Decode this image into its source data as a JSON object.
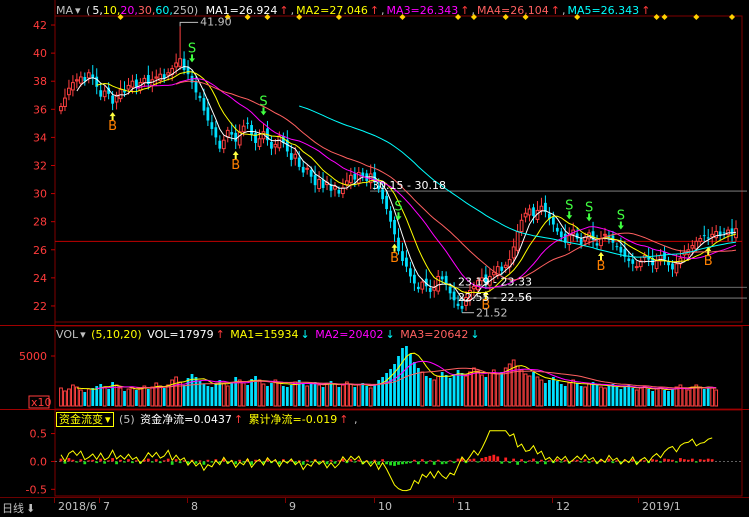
{
  "main_header": {
    "indicator": "MA",
    "params": [
      "5",
      "10",
      "20",
      "30",
      "60",
      "250"
    ],
    "ma": [
      {
        "label": "MA1=26.924",
        "color": "#ffffff"
      },
      {
        "label": "MA2=27.046",
        "color": "#ffff00"
      },
      {
        "label": "MA3=26.343",
        "color": "#ff00ff"
      },
      {
        "label": "MA4=26.104",
        "color": "#ff6060"
      },
      {
        "label": "MA5=26.343",
        "color": "#00ffff"
      }
    ]
  },
  "vol_header": {
    "indicator": "VOL",
    "params": "(5,10,20)",
    "vol": "VOL=17979",
    "ma1": "MA1=15934",
    "ma2": "MA2=20402",
    "ma3": "MA3=20642"
  },
  "fund_header": {
    "indicator": "资金流变",
    "param": "(5)",
    "net": "资金净流=0.0437",
    "cum": "累计净流=-0.019",
    "tail": ","
  },
  "bottom": {
    "period_label": "日线",
    "dates": [
      "2018/6",
      "7",
      "8",
      "9",
      "10",
      "11",
      "12",
      "2019/1"
    ]
  },
  "chart_data": [
    {
      "type": "candlestick",
      "title": "",
      "y_ticks": [
        22,
        24,
        26,
        28,
        30,
        32,
        34,
        36,
        38,
        40,
        42
      ],
      "ylim": [
        21.0,
        42.5
      ],
      "annotations": [
        {
          "text": "41.90",
          "kind": "high"
        },
        {
          "text": "21.52",
          "kind": "low"
        },
        {
          "text": "30.15 - 30.18",
          "kind": "gap"
        },
        {
          "text": "23.19 - 23.33",
          "kind": "gap"
        },
        {
          "text": "22.55 - 22.56",
          "kind": "gap"
        }
      ],
      "reference_line": 26.6,
      "gap_levels": [
        30.18,
        23.33,
        22.56
      ],
      "signals": [
        {
          "type": "B",
          "i": 13
        },
        {
          "type": "S",
          "i": 33
        },
        {
          "type": "B",
          "i": 44
        },
        {
          "type": "S",
          "i": 51
        },
        {
          "type": "S",
          "i": 85
        },
        {
          "type": "B",
          "i": 84
        },
        {
          "type": "B",
          "i": 107
        },
        {
          "type": "S",
          "i": 128
        },
        {
          "type": "S",
          "i": 133
        },
        {
          "type": "B",
          "i": 136
        },
        {
          "type": "S",
          "i": 141
        },
        {
          "type": "B",
          "i": 163
        }
      ],
      "series": {
        "close": [
          36.2,
          36.8,
          37.5,
          37.9,
          38.1,
          38.3,
          38.0,
          38.6,
          38.2,
          37.6,
          36.9,
          37.3,
          37.1,
          36.4,
          37.0,
          37.4,
          37.2,
          37.7,
          38.0,
          37.6,
          37.9,
          38.2,
          37.8,
          38.1,
          38.3,
          38.5,
          38.2,
          38.6,
          38.9,
          39.3,
          39.6,
          38.8,
          38.5,
          37.9,
          37.2,
          36.8,
          35.9,
          35.2,
          34.6,
          34.0,
          33.2,
          33.8,
          34.5,
          34.2,
          33.7,
          34.4,
          34.8,
          35.0,
          34.2,
          33.6,
          33.9,
          34.4,
          33.8,
          33.2,
          33.5,
          34.1,
          33.6,
          33.0,
          32.4,
          32.8,
          31.9,
          31.5,
          31.8,
          31.2,
          30.6,
          31.0,
          30.4,
          30.8,
          30.2,
          30.5,
          30.0,
          30.4,
          30.9,
          31.3,
          31.0,
          31.5,
          31.2,
          30.9,
          31.4,
          30.8,
          30.3,
          29.6,
          28.9,
          28.0,
          27.1,
          25.9,
          25.2,
          24.8,
          24.1,
          23.6,
          23.2,
          23.7,
          23.4,
          23.0,
          23.3,
          24.1,
          23.9,
          23.5,
          22.9,
          22.4,
          22.0,
          21.8,
          22.6,
          23.1,
          23.4,
          23.8,
          24.0,
          23.6,
          24.1,
          24.4,
          24.8,
          24.5,
          24.9,
          25.3,
          26.2,
          27.3,
          28.1,
          28.6,
          28.9,
          28.4,
          28.8,
          29.1,
          28.7,
          28.2,
          27.8,
          27.3,
          26.9,
          26.5,
          27.0,
          27.4,
          26.8,
          26.4,
          26.9,
          27.2,
          26.7,
          26.3,
          26.8,
          27.1,
          26.9,
          26.5,
          26.2,
          25.8,
          25.5,
          25.2,
          25.0,
          24.8,
          25.2,
          25.6,
          25.3,
          24.9,
          25.2,
          25.6,
          25.3,
          24.9,
          24.6,
          25.0,
          25.4,
          25.8,
          26.0,
          26.3,
          26.6,
          26.8,
          27.0,
          26.8,
          27.1,
          27.3,
          27.0,
          27.2,
          27.4,
          27.1,
          27.5
        ],
        "ma_white": [],
        "ma_yellow": [],
        "ma_magenta": [],
        "ma_red": [],
        "ma_cyan_start": 60
      }
    },
    {
      "type": "bar",
      "title": "",
      "y_ticks": [
        5000
      ],
      "ylim": [
        0,
        6200
      ],
      "unit": "x10",
      "volume": [
        1800,
        1500,
        1700,
        2100,
        1900,
        1600,
        1400,
        1700,
        1800,
        2000,
        2200,
        1900,
        1700,
        2400,
        2100,
        1800,
        1500,
        1700,
        1900,
        1600,
        1800,
        2000,
        1700,
        1900,
        2300,
        2000,
        1800,
        2100,
        2600,
        2900,
        2400,
        2100,
        2800,
        3200,
        2900,
        2500,
        2200,
        2000,
        1900,
        2300,
        2600,
        2300,
        2000,
        2400,
        2900,
        2600,
        2300,
        2100,
        2700,
        3000,
        2600,
        2200,
        2000,
        2300,
        2600,
        2300,
        2000,
        1900,
        2100,
        2400,
        2600,
        2300,
        2000,
        2200,
        2400,
        2100,
        1900,
        2200,
        2500,
        2200,
        1900,
        2100,
        2400,
        2200,
        1900,
        2100,
        2300,
        2000,
        1800,
        2200,
        2600,
        2900,
        3300,
        3700,
        4200,
        5000,
        5800,
        6000,
        5200,
        4400,
        3800,
        3400,
        3000,
        2800,
        2600,
        3000,
        3400,
        3100,
        2800,
        3200,
        3600,
        3300,
        3000,
        3400,
        3800,
        3500,
        3100,
        2900,
        3300,
        3600,
        3200,
        3400,
        3800,
        4200,
        4600,
        4000,
        3600,
        3200,
        3000,
        3400,
        2900,
        2600,
        2300,
        2600,
        2900,
        2500,
        2200,
        2000,
        2300,
        2600,
        2300,
        2000,
        1900,
        2200,
        2400,
        2100,
        1900,
        1800,
        2000,
        2200,
        1900,
        1700,
        1900,
        2100,
        1800,
        1600,
        1800,
        2000,
        1700,
        1500,
        1700,
        1900,
        1600,
        1500,
        1700,
        1900,
        2100,
        1800,
        1600,
        1900,
        2100,
        1900,
        1700,
        1900,
        1800,
        1600
      ]
    },
    {
      "type": "bar",
      "title": "",
      "y_ticks": [
        0.5,
        0.0,
        -0.5
      ],
      "ylim": [
        -0.62,
        0.6
      ],
      "flows": [
        0.05,
        -0.04,
        0.06,
        0.03,
        -0.02,
        0.04,
        -0.05,
        0.02,
        0.03,
        -0.03,
        0.05,
        -0.04,
        0.02,
        0.06,
        -0.05,
        0.03,
        -0.02,
        0.04,
        -0.03,
        0.02,
        -0.04,
        0.03,
        0.05,
        -0.02,
        0.04,
        -0.03,
        0.02,
        0.05,
        -0.06,
        0.04,
        -0.03,
        0.02,
        -0.05,
        0.03,
        -0.04,
        0.02,
        -0.06,
        0.03,
        -0.02,
        0.04,
        -0.03,
        0.05,
        -0.04,
        0.02,
        -0.05,
        0.03,
        -0.02,
        0.04,
        -0.06,
        0.03,
        0.02,
        -0.04,
        0.05,
        -0.03,
        0.02,
        -0.05,
        0.04,
        -0.02,
        0.03,
        -0.04,
        0.02,
        -0.06,
        0.03,
        -0.02,
        0.04,
        -0.03,
        0.02,
        -0.05,
        0.03,
        -0.04,
        0.02,
        0.05,
        -0.03,
        0.04,
        -0.02,
        0.03,
        -0.05,
        0.02,
        -0.04,
        0.03,
        -0.06,
        0.04,
        -0.05,
        -0.07,
        -0.08,
        -0.06,
        -0.05,
        -0.04,
        -0.03,
        0.03,
        -0.05,
        0.04,
        -0.04,
        0.02,
        -0.06,
        0.03,
        -0.05,
        -0.04,
        0.02,
        -0.03,
        0.05,
        0.06,
        -0.03,
        0.04,
        0.05,
        -0.02,
        0.06,
        0.08,
        0.1,
        0.12,
        0.09,
        -0.04,
        0.07,
        -0.03,
        0.05,
        -0.06,
        0.04,
        -0.03,
        0.02,
        0.05,
        -0.04,
        0.03,
        -0.05,
        0.02,
        -0.03,
        0.04,
        -0.02,
        0.03,
        -0.04,
        0.02,
        0.03,
        -0.02,
        0.04,
        -0.03,
        0.02,
        -0.04,
        0.03,
        -0.02,
        0.05,
        -0.03,
        0.02,
        -0.04,
        0.03,
        -0.02,
        0.04,
        -0.05,
        0.03,
        0.02,
        -0.03,
        0.04,
        0.03,
        -0.02,
        0.05,
        0.04,
        0.03,
        -0.02,
        0.06,
        0.04,
        0.03,
        0.05,
        -0.02,
        0.04,
        0.03,
        0.05,
        0.04
      ]
    }
  ]
}
